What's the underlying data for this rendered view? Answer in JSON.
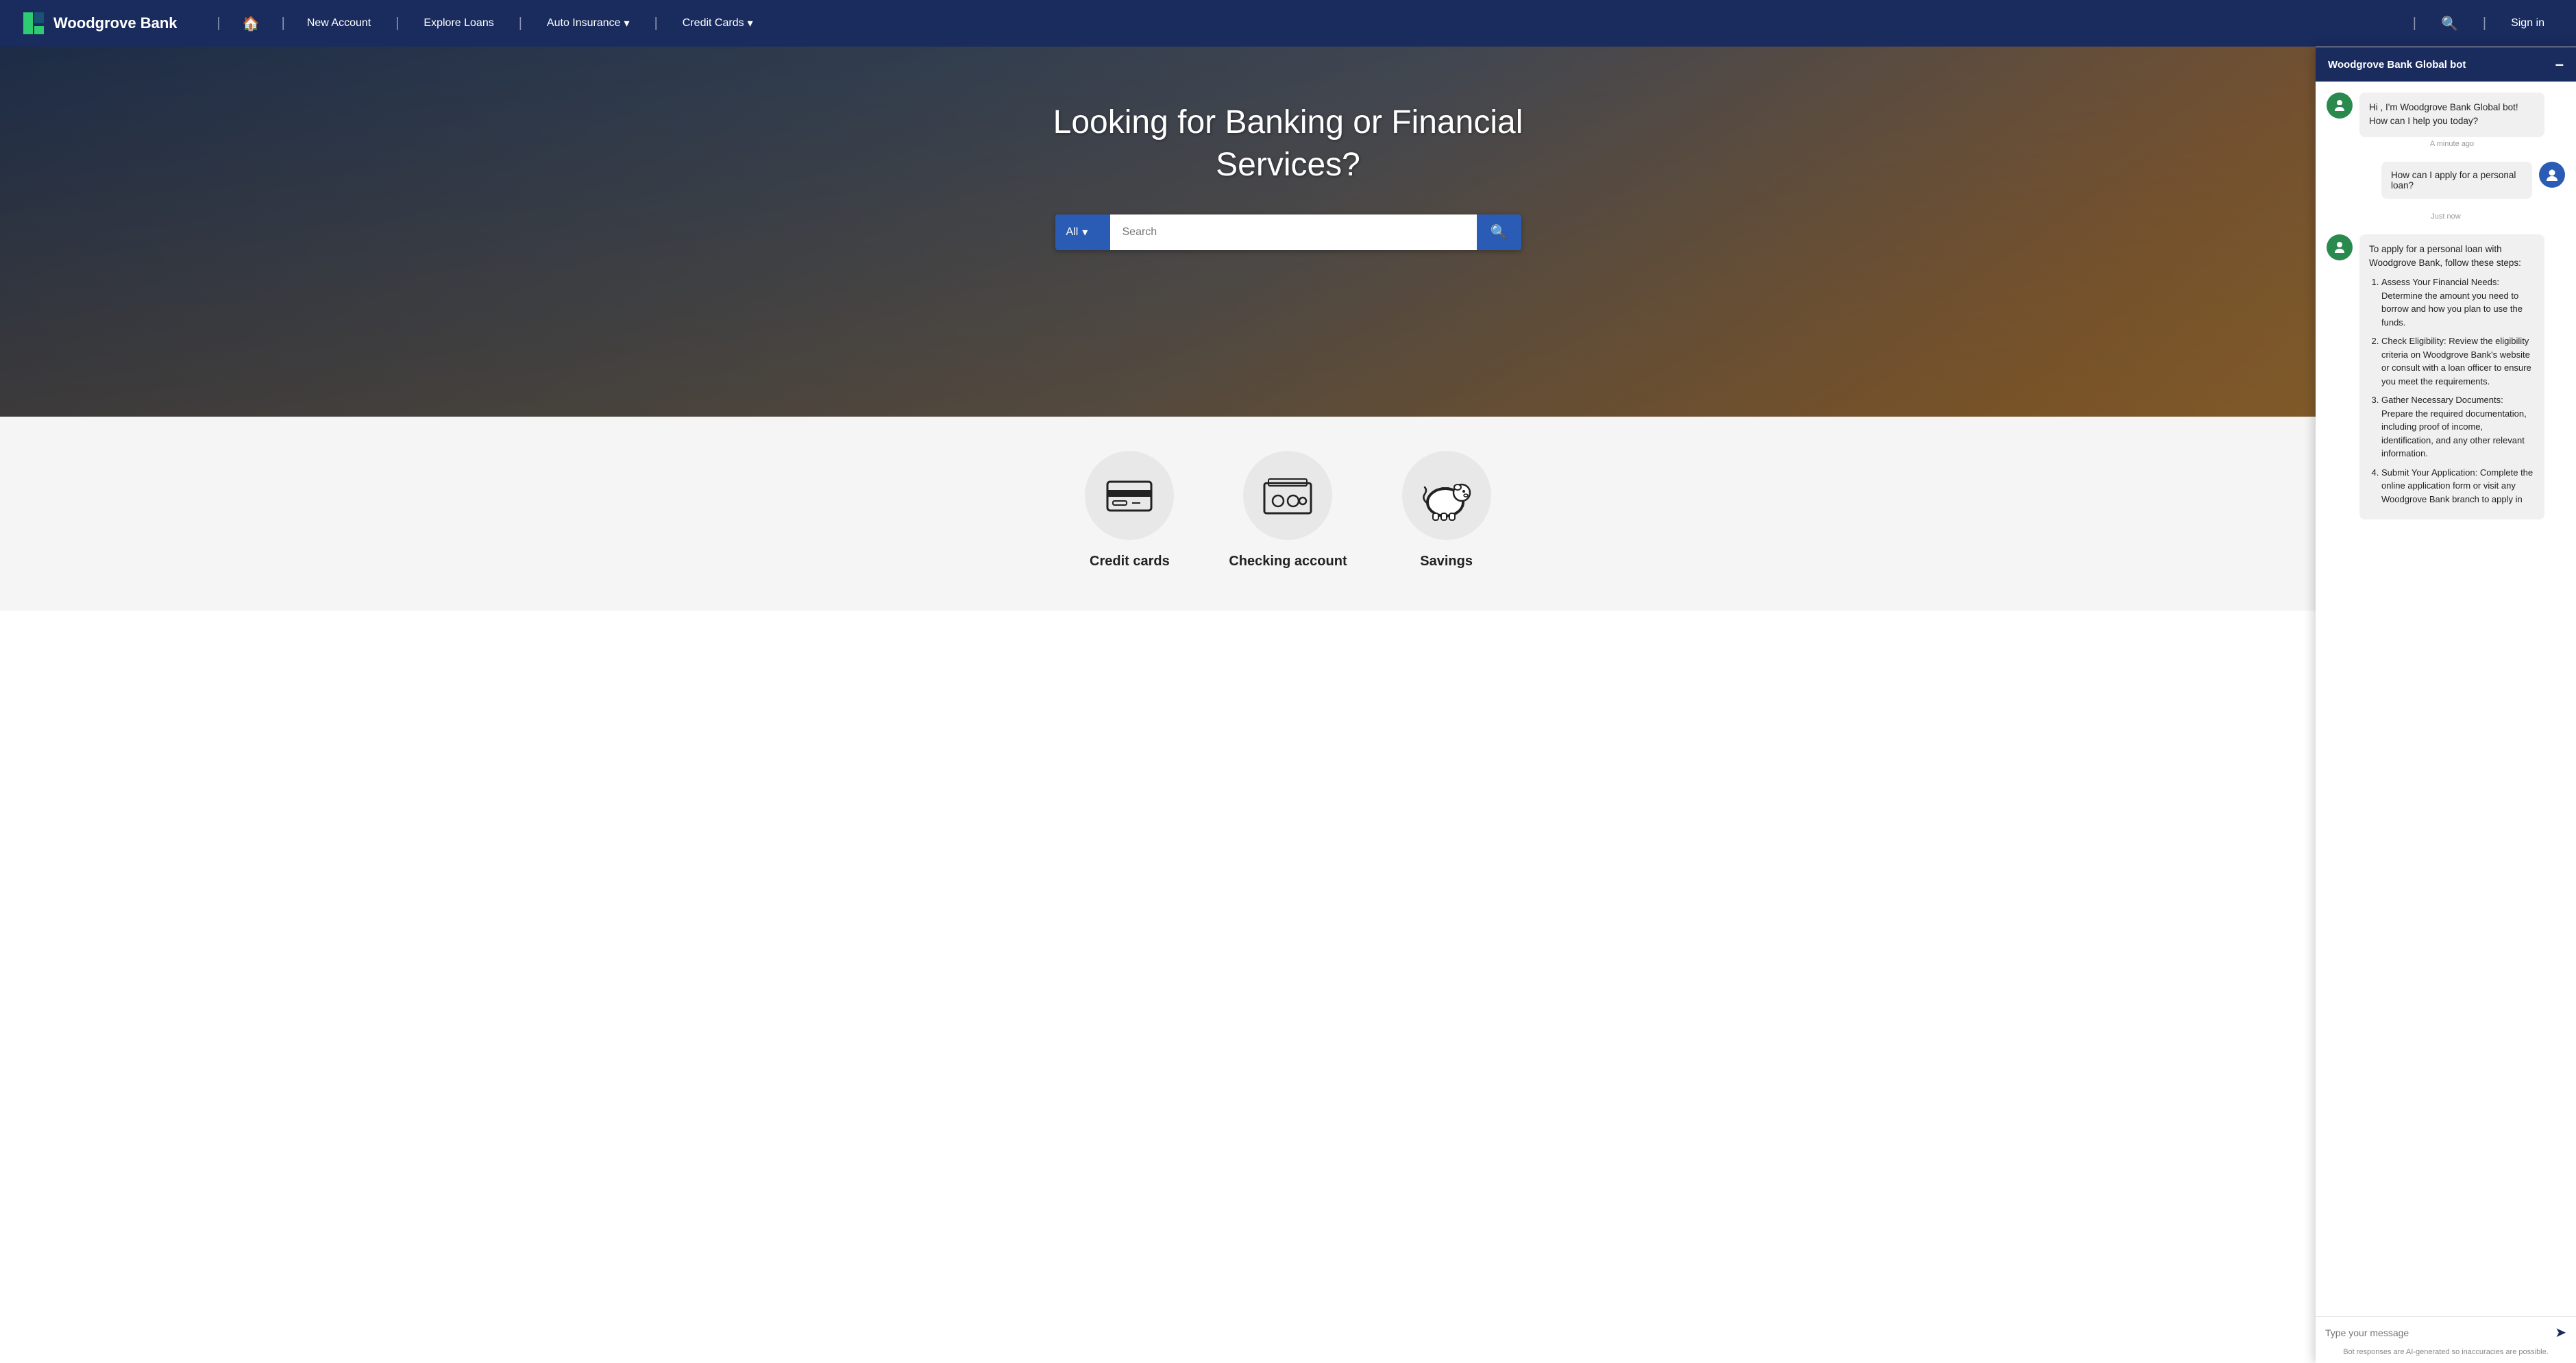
{
  "navbar": {
    "brand": "Woodgrove Bank",
    "home_icon": "🏠",
    "nav_items": [
      {
        "label": "New Account",
        "has_dropdown": false
      },
      {
        "label": "Explore Loans",
        "has_dropdown": false
      },
      {
        "label": "Auto Insurance",
        "has_dropdown": true
      },
      {
        "label": "Credit Cards",
        "has_dropdown": true
      }
    ],
    "search_icon": "🔍",
    "signin_label": "Sign in"
  },
  "hero": {
    "title": "Looking for Banking or Financial Services?",
    "search": {
      "dropdown_label": "All",
      "placeholder": "Search",
      "button_icon": "🔍"
    }
  },
  "services": [
    {
      "label": "Credit cards"
    },
    {
      "label": "Checking account"
    },
    {
      "label": "Savings"
    }
  ],
  "chatbot": {
    "title": "Woodgrove Bank Global bot",
    "minimize_label": "–",
    "messages": [
      {
        "type": "bot",
        "text": "Hi , I'm Woodgrove Bank Global bot! How can I help you today?",
        "time": "A minute ago"
      },
      {
        "type": "user",
        "text": "How can I apply for a personal loan?",
        "time": "Just now"
      },
      {
        "type": "bot",
        "text": "To apply for a personal loan with Woodgrove Bank, follow these steps:",
        "steps": [
          "Assess Your Financial Needs: Determine the amount you need to borrow and how you plan to use the funds.",
          "Check Eligibility: Review the eligibility criteria on Woodgrove Bank's website or consult with a loan officer to ensure you meet the requirements.",
          "Gather Necessary Documents: Prepare the required documentation, including proof of income, identification, and any other relevant information.",
          "Submit Your Application: Complete the online application form or visit any Woodgrove Bank branch to apply in"
        ],
        "time": null
      }
    ],
    "input_placeholder": "Type your message",
    "disclaimer": "Bot responses are AI-generated so inaccuracies are possible.",
    "send_icon": "➤"
  }
}
